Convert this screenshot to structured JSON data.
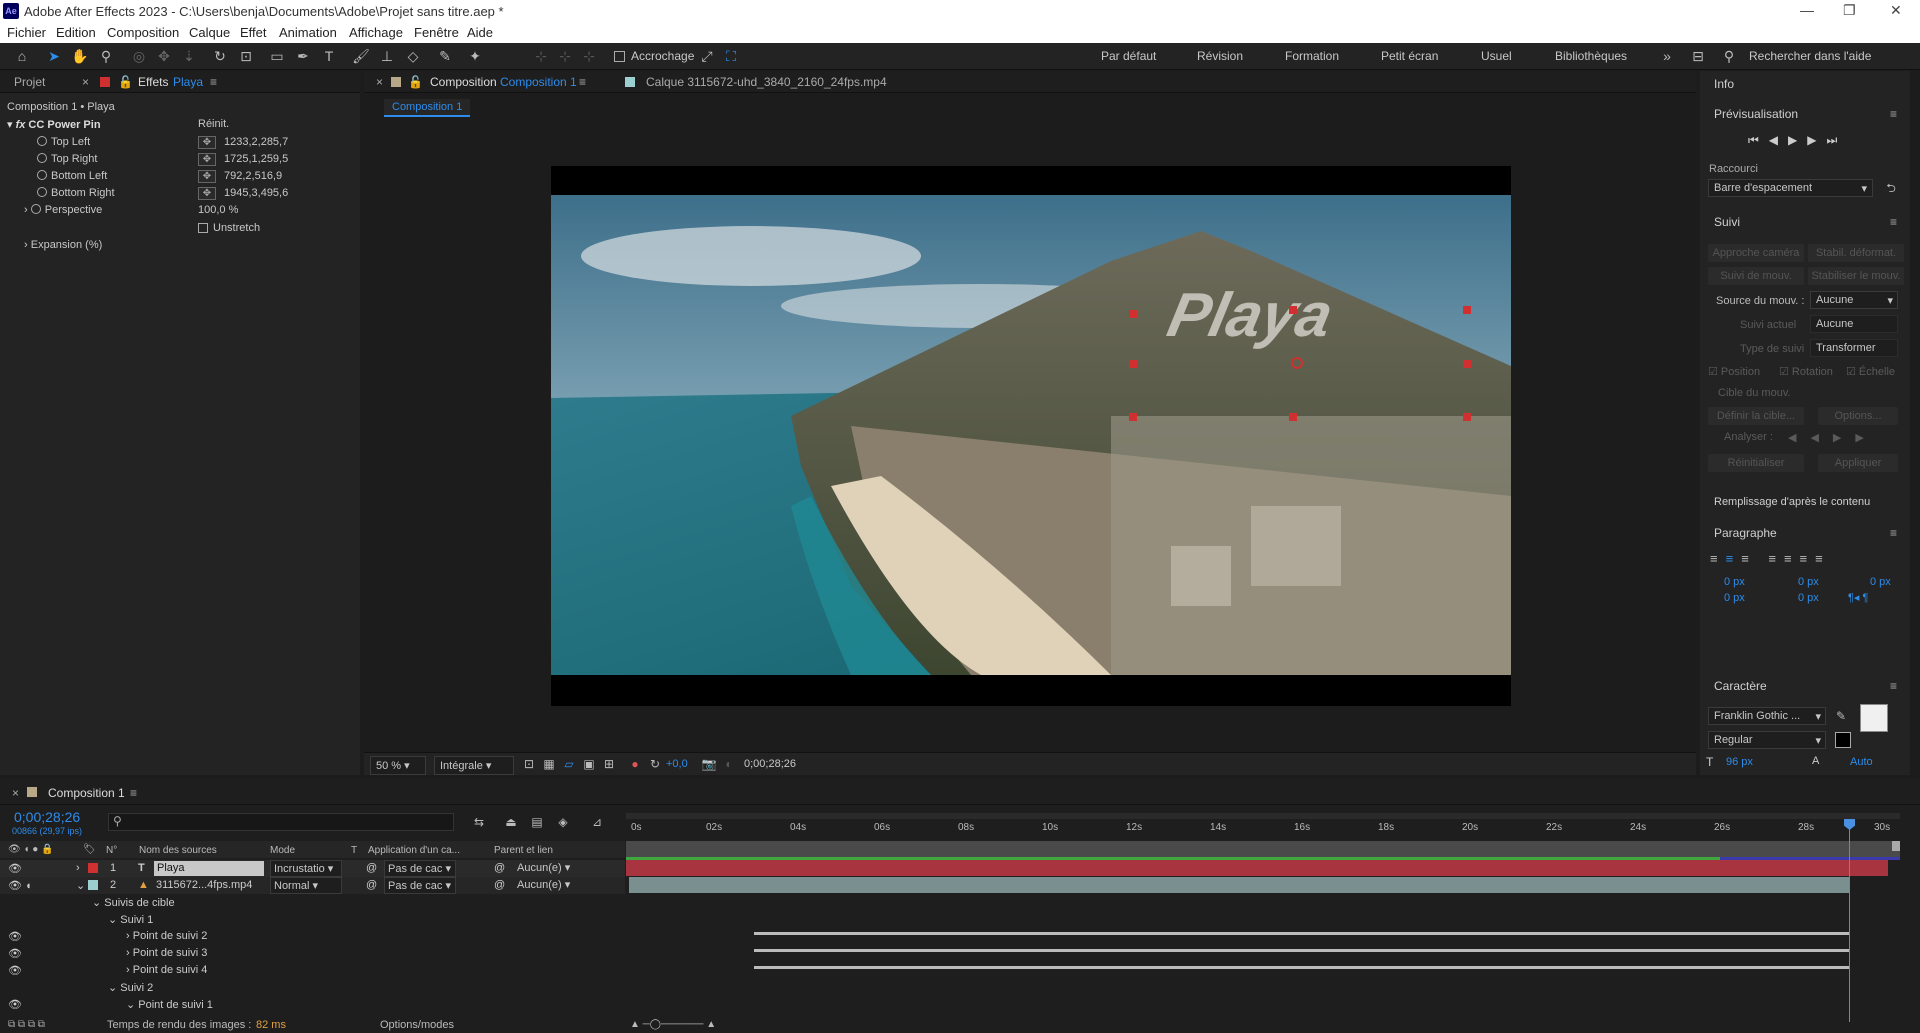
{
  "app": {
    "title": "Adobe After Effects 2023 - C:\\Users\\benja\\Documents\\Adobe\\Projet sans titre.aep *",
    "logo": "Ae"
  },
  "menu": [
    "Fichier",
    "Edition",
    "Composition",
    "Calque",
    "Effet",
    "Animation",
    "Affichage",
    "Fenêtre",
    "Aide"
  ],
  "toolbar": {
    "snap_label": "Accrochage",
    "workspaces": [
      "Par défaut",
      "Révision",
      "Formation",
      "Petit écran",
      "Usuel",
      "Bibliothèques"
    ],
    "search_placeholder": "Rechercher dans l'aide"
  },
  "left_panel": {
    "tab_project": "Projet",
    "tab_effects": "Effets",
    "tab_effects_layer": "Playa",
    "breadcrumb": "Composition 1 • Playa",
    "effect_name": "CC Power Pin",
    "reset": "Réinit.",
    "props": [
      {
        "name": "Top Left",
        "value": "1233,2,285,7"
      },
      {
        "name": "Top Right",
        "value": "1725,1,259,5"
      },
      {
        "name": "Bottom Left",
        "value": "792,2,516,9"
      },
      {
        "name": "Bottom Right",
        "value": "1945,3,495,6"
      }
    ],
    "perspective": {
      "name": "Perspective",
      "value": "100,0 %"
    },
    "unstretch": "Unstretch",
    "expansion": "Expansion (%)"
  },
  "viewer": {
    "tab_prefix": "Composition",
    "tab_comp": "Composition 1",
    "layer_tab": "Calque  3115672-uhd_3840_2160_24fps.mp4",
    "comp_chip": "Composition 1",
    "text_overlay": "Playa",
    "zoom": "50 %",
    "resolution": "Intégrale",
    "exposure": "+0,0",
    "timecode": "0;00;28;26"
  },
  "right_panel": {
    "info": "Info",
    "preview": "Prévisualisation",
    "shortcut_label": "Raccourci",
    "shortcut_value": "Barre d'espacement",
    "tracking": "Suivi",
    "btn_camera": "Approche caméra",
    "btn_stab": "Stabil. déformat.",
    "btn_track": "Suivi de mouv.",
    "btn_stab2": "Stabiliser le mouv.",
    "source_label": "Source du mouv. :",
    "source_value": "Aucune",
    "current_label": "Suivi actuel",
    "current_value": "Aucune",
    "type_label": "Type de suivi",
    "type_value": "Transformer",
    "chk_position": "Position",
    "chk_rotation": "Rotation",
    "chk_scale": "Échelle",
    "target": "Cible du mouv.",
    "define_target": "Définir la cible...",
    "options": "Options...",
    "analyse": "Analyser :",
    "reset": "Réinitialiser",
    "apply": "Appliquer",
    "fill": "Remplissage d'après le contenu",
    "paragraph": "Paragraphe",
    "para_values": [
      "0 px",
      "0 px",
      "0 px",
      "0 px",
      "0 px"
    ],
    "character": "Caractère",
    "font": "Franklin Gothic ...",
    "style": "Regular",
    "size": "96 px",
    "leading": "Auto"
  },
  "timeline": {
    "tab": "Composition 1",
    "timecode": "0;00;28;26",
    "fps": "00866 (29,97 ips)",
    "col_headers": {
      "num": "N°",
      "source": "Nom des sources",
      "mode": "Mode",
      "t": "T",
      "matte": "Application d'un ca...",
      "parent": "Parent et lien"
    },
    "layers": [
      {
        "num": "1",
        "name": "Playa",
        "mode": "Incrustatio",
        "matte": "Pas de cac",
        "parent": "Aucun(e)"
      },
      {
        "num": "2",
        "name": "3115672...4fps.mp4",
        "mode": "Normal",
        "matte": "Pas de cac",
        "parent": "Aucun(e)"
      }
    ],
    "tree": [
      "Suivis de cible",
      "Suivi 1",
      "Point de suivi 2",
      "Point de suivi 3",
      "Point de suivi 4",
      "Suivi 2",
      "Point de suivi 1"
    ],
    "ruler": [
      "0s",
      "02s",
      "04s",
      "06s",
      "08s",
      "10s",
      "12s",
      "14s",
      "16s",
      "18s",
      "20s",
      "22s",
      "24s",
      "26s",
      "28s",
      "30s"
    ],
    "render_time_label": "Temps de rendu des images :",
    "render_time": "82 ms",
    "options_modes": "Options/modes"
  }
}
